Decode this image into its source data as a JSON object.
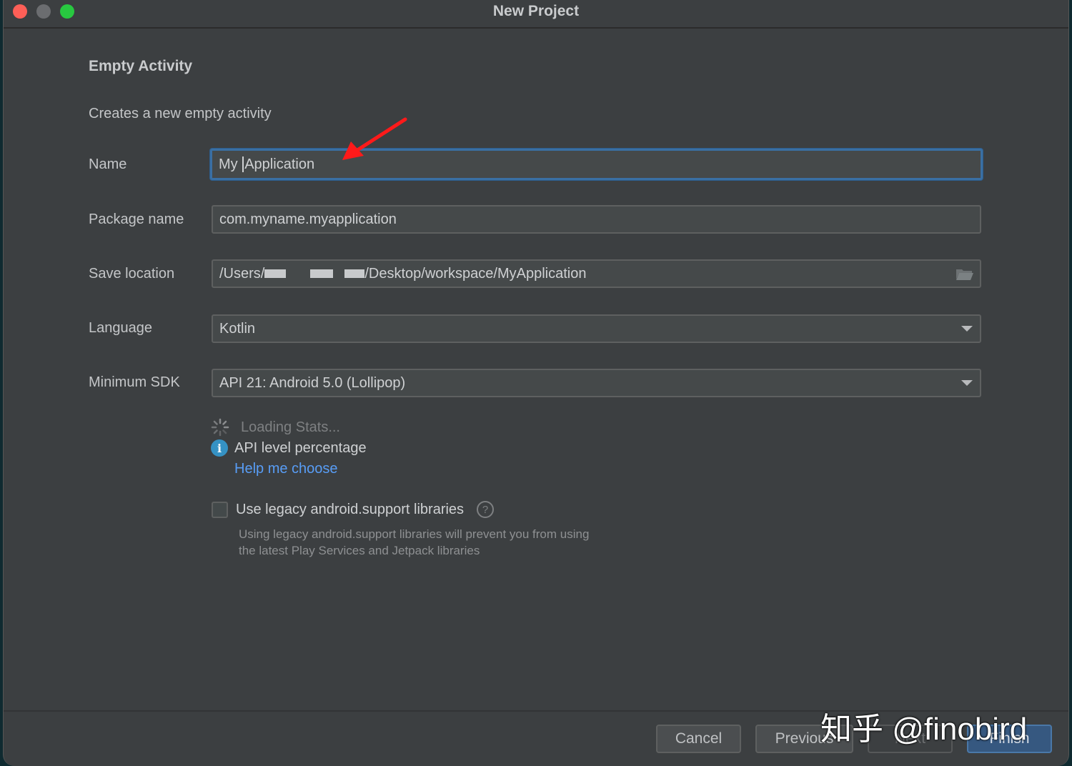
{
  "window": {
    "title": "New Project",
    "traffic_lights": [
      "close",
      "minimize",
      "maximize"
    ]
  },
  "template": {
    "heading": "Empty Activity",
    "description": "Creates a new empty activity"
  },
  "form": {
    "name": {
      "label": "Name",
      "value_before_caret": "My ",
      "value_after_caret": "Application",
      "value": "My Application"
    },
    "package_name": {
      "label": "Package name",
      "value": "com.myname.myapplication"
    },
    "save_location": {
      "label": "Save location",
      "value_prefix": "/Users/",
      "value_suffix": "/Desktop/workspace/MyApplication",
      "icon": "folder-icon"
    },
    "language": {
      "label": "Language",
      "value": "Kotlin"
    },
    "minimum_sdk": {
      "label": "Minimum SDK",
      "value": "API 21: Android 5.0 (Lollipop)"
    }
  },
  "sdk_info": {
    "loading": "Loading Stats...",
    "api_level": "API level percentage",
    "help_link": "Help me choose"
  },
  "legacy": {
    "checkbox_label": "Use legacy android.support libraries",
    "checked": false,
    "description_line1": "Using legacy android.support libraries will prevent you from using",
    "description_line2": "the latest Play Services and Jetpack libraries"
  },
  "buttons": {
    "cancel": "Cancel",
    "previous": "Previous",
    "next": "Next",
    "finish": "Finish"
  },
  "watermark": "知乎 @finobird",
  "colors": {
    "background": "#3c3f41",
    "focus_border": "#3a6fa3",
    "link": "#589df6",
    "primary_button": "#365880",
    "annotation_arrow": "#ff1a1a"
  }
}
